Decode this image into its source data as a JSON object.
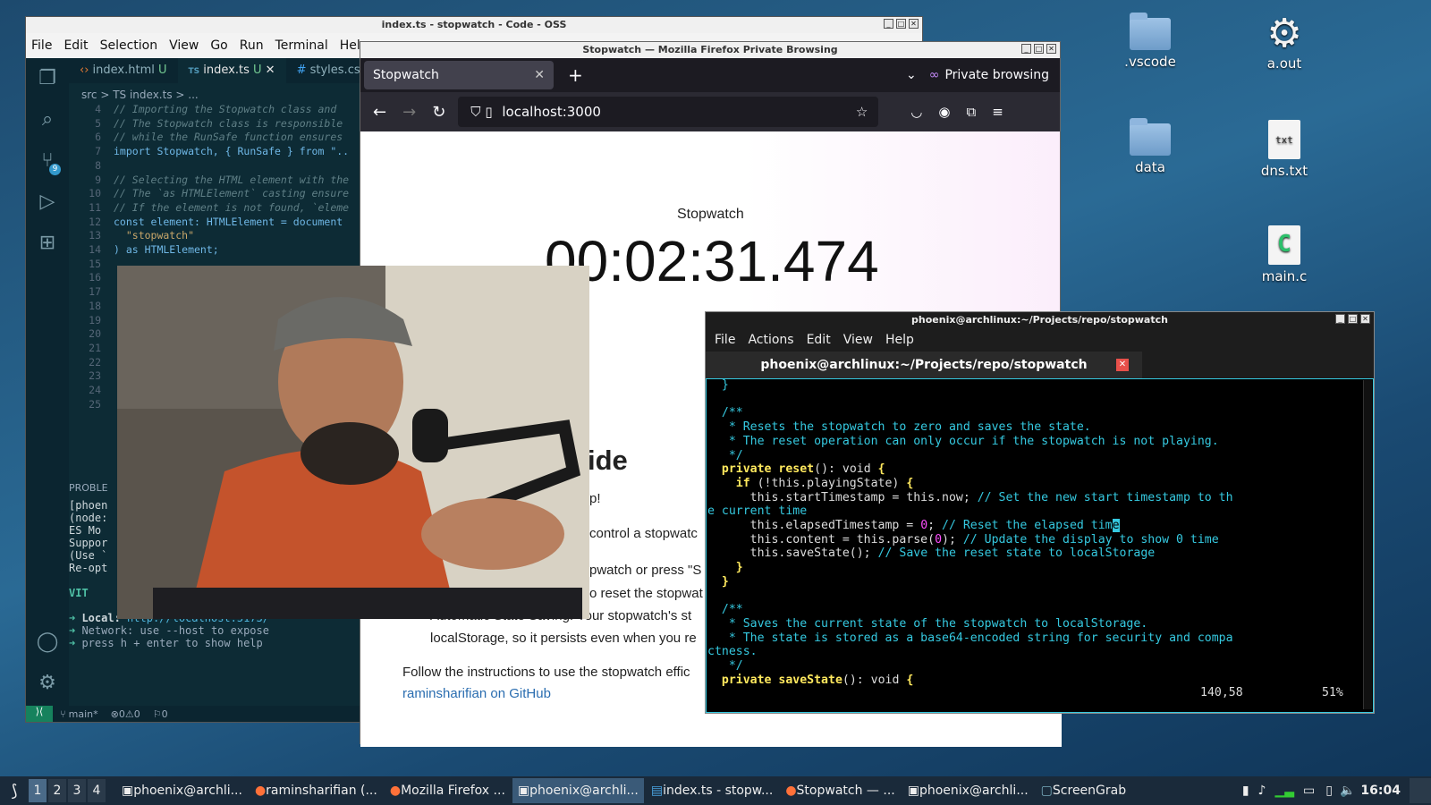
{
  "desktop": {
    "icons": [
      {
        "label": ".vscode",
        "kind": "folder"
      },
      {
        "label": "a.out",
        "kind": "gear"
      },
      {
        "label": "data",
        "kind": "folder"
      },
      {
        "label": "dns.txt",
        "kind": "txt",
        "badge": "txt"
      },
      {
        "label": "main.c",
        "kind": "c-source"
      }
    ]
  },
  "vscode": {
    "title": "index.ts - stopwatch - Code - OSS",
    "menu": [
      "File",
      "Edit",
      "Selection",
      "View",
      "Go",
      "Run",
      "Terminal",
      "Help"
    ],
    "tabs": [
      {
        "label": "index.html",
        "status": "U",
        "icon": "‹›"
      },
      {
        "label": "index.ts",
        "status": "U",
        "icon": "TS"
      },
      {
        "label": "styles.css",
        "status": "",
        "icon": "#"
      }
    ],
    "breadcrumb": "src > TS index.ts > ...",
    "scm_badge": "9",
    "code_lines": [
      {
        "n": "4",
        "t": "// Importing the Stopwatch class and",
        "c": "cm"
      },
      {
        "n": "5",
        "t": "// The Stopwatch class is responsible",
        "c": "cm"
      },
      {
        "n": "6",
        "t": "// while the RunSafe function ensures",
        "c": "cm"
      },
      {
        "n": "7",
        "t": "import Stopwatch, { RunSafe } from \"..",
        "c": ""
      },
      {
        "n": "8",
        "t": "",
        "c": ""
      },
      {
        "n": "9",
        "t": "// Selecting the HTML element with the",
        "c": "cm"
      },
      {
        "n": "10",
        "t": "// The `as HTMLElement` casting ensure",
        "c": "cm"
      },
      {
        "n": "11",
        "t": "// If the element is not found, `eleme",
        "c": "cm"
      },
      {
        "n": "12",
        "t": "const element: HTMLElement = document",
        "c": ""
      },
      {
        "n": "13",
        "t": "  \"stopwatch\"",
        "c": "st"
      },
      {
        "n": "14",
        "t": ") as HTMLElement;",
        "c": ""
      },
      {
        "n": "15",
        "t": "",
        "c": ""
      },
      {
        "n": "16",
        "t": "",
        "c": ""
      },
      {
        "n": "17",
        "t": "",
        "c": ""
      },
      {
        "n": "18",
        "t": "",
        "c": ""
      },
      {
        "n": "19",
        "t": "",
        "c": ""
      },
      {
        "n": "20",
        "t": "",
        "c": ""
      },
      {
        "n": "21",
        "t": "",
        "c": ""
      },
      {
        "n": "22",
        "t": "",
        "c": ""
      },
      {
        "n": "23",
        "t": "",
        "c": ""
      },
      {
        "n": "24",
        "t": "",
        "c": ""
      },
      {
        "n": "25",
        "t": "",
        "c": ""
      }
    ],
    "panel": {
      "header": "PROBLE",
      "lines": [
        "[phoen",
        "(node:",
        "  ES Mo",
        "Suppor",
        "(Use `",
        "Re-opt"
      ],
      "vite": "VIT",
      "local_label": "Local:",
      "local_url": "http://localhost:5173/",
      "network_label": "Network:",
      "network_text": "use --host to expose",
      "help_text": "press h + enter to show help"
    },
    "status": {
      "branch": "main*",
      "errors": "0",
      "warnings": "0",
      "ports": "0"
    }
  },
  "firefox": {
    "title": "Stopwatch — Mozilla Firefox Private Browsing",
    "tab": "Stopwatch",
    "private_label": "Private browsing",
    "url": "localhost:3000",
    "page": {
      "label": "Stopwatch",
      "time": "00:02:31.474",
      "heading": "ide",
      "line1": "p!",
      "line2": "control a stopwatc",
      "line3": "pwatch or press \"S",
      "line4": "o reset the stopwat",
      "line5": "Automatic State Saving: Your stopwatch's st",
      "line6": "localStorage, so it persists even when you re",
      "follow": "Follow the instructions to use the stopwatch effic",
      "link": "raminsharifian on GitHub"
    }
  },
  "terminal": {
    "title": "phoenix@archlinux:~/Projects/repo/stopwatch",
    "menu": [
      "File",
      "Actions",
      "Edit",
      "View",
      "Help"
    ],
    "tab": "phoenix@archlinux:~/Projects/repo/stopwatch",
    "position": "140,58",
    "percent": "51%"
  },
  "taskbar": {
    "workspaces": [
      "1",
      "2",
      "3",
      "4"
    ],
    "items": [
      "phoenix@archli...",
      "raminsharifian (...",
      "Mozilla Firefox ...",
      "phoenix@archli...",
      "index.ts - stopw...",
      "Stopwatch — ...",
      "phoenix@archli...",
      "ScreenGrab"
    ],
    "clock": "16:04"
  }
}
